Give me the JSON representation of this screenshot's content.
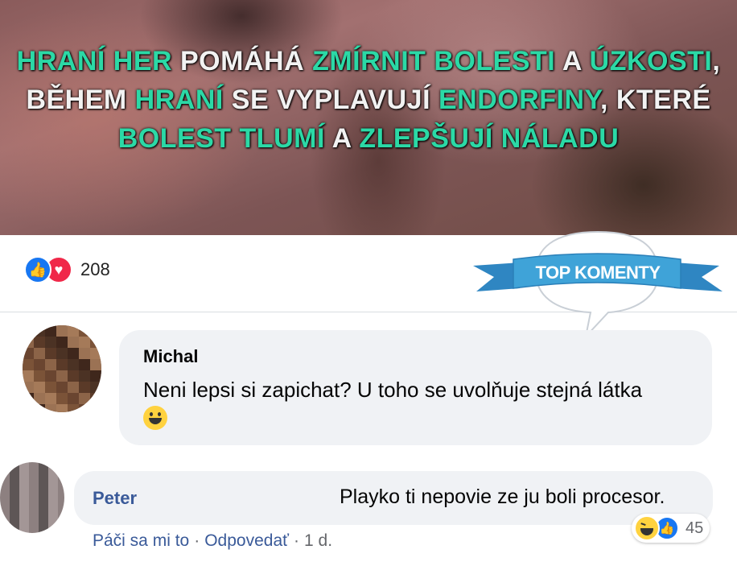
{
  "banner": {
    "lines": [
      [
        {
          "t": "HRANÍ HER",
          "c": "g"
        },
        {
          "t": " POMÁHÁ ",
          "c": "w"
        },
        {
          "t": "ZMÍRNIT BOLESTI",
          "c": "g"
        },
        {
          "t": " A ",
          "c": "w"
        },
        {
          "t": "ÚZKOSTI",
          "c": "g"
        },
        {
          "t": ",",
          "c": "w"
        }
      ],
      [
        {
          "t": "BĚHEM ",
          "c": "w"
        },
        {
          "t": "HRANÍ",
          "c": "g"
        },
        {
          "t": " SE VYPLAVUJÍ ",
          "c": "w"
        },
        {
          "t": "ENDORFINY",
          "c": "g"
        },
        {
          "t": ", KTERÉ",
          "c": "w"
        }
      ],
      [
        {
          "t": "BOLEST TLUMÍ",
          "c": "g"
        },
        {
          "t": " A ",
          "c": "w"
        },
        {
          "t": "ZLEPŠUJÍ NÁLADU",
          "c": "g"
        }
      ]
    ]
  },
  "post": {
    "reaction_count": "208",
    "reaction_icons": [
      "like-icon",
      "love-icon"
    ]
  },
  "badge": {
    "label": "TOP KOMENTY"
  },
  "comments": [
    {
      "author": "Michal",
      "text": "Neni lepsi si zapichat? U toho se uvolňuje stejná látka",
      "emoji": "grinning-face-emoji"
    },
    {
      "author": "Peter",
      "text": "Playko ti nepovie ze ju boli procesor.",
      "actions": {
        "like": "Páči sa mi to",
        "reply": "Odpovedať",
        "separator": "·",
        "time": "1 d."
      },
      "reaction_count": "45",
      "reaction_icons": [
        "haha-icon",
        "like-icon"
      ]
    }
  ],
  "colors": {
    "accent_green": "#2bd9a6",
    "facebook_blue": "#1877f2",
    "love_red": "#f02849",
    "ribbon_blue": "#3fa3d8",
    "link_blue": "#3a5a99"
  }
}
